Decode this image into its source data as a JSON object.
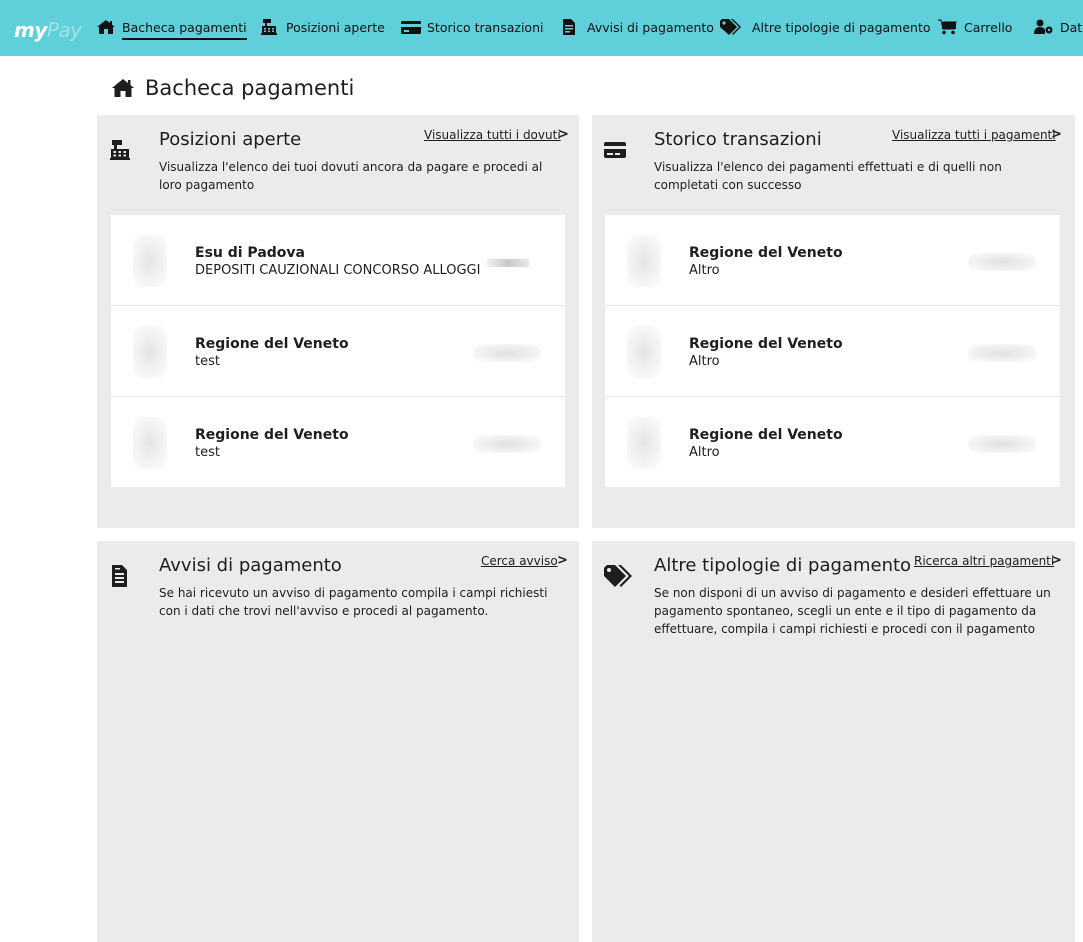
{
  "app": {
    "logo_my": "my",
    "logo_pay": "Pay"
  },
  "nav": {
    "items": [
      {
        "label": "Bacheca pagamenti",
        "icon": "home-icon",
        "active": true
      },
      {
        "label": "Posizioni aperte",
        "icon": "cash-register-icon"
      },
      {
        "label": "Storico transazioni",
        "icon": "credit-card-icon"
      },
      {
        "label": "Avvisi di pagamento",
        "icon": "file-invoice-icon"
      },
      {
        "label": "Altre tipologie di pagamento",
        "icon": "tags-icon"
      },
      {
        "label": "Carrello",
        "icon": "cart-icon"
      },
      {
        "label": "Dat",
        "icon": "user-cog-icon"
      }
    ]
  },
  "page": {
    "title": "Bacheca pagamenti"
  },
  "panels": {
    "posizioni": {
      "title": "Posizioni aperte",
      "description": "Visualizza l'elenco dei tuoi dovuti ancora da pagare e procedi al loro pagamento",
      "link": "Visualizza tutti i dovuti",
      "items": [
        {
          "ente": "Esu di Padova",
          "causale": "DEPOSITI CAUZIONALI CONCORSO ALLOGGI"
        },
        {
          "ente": "Regione del Veneto",
          "causale": "test"
        },
        {
          "ente": "Regione del Veneto",
          "causale": "test"
        }
      ]
    },
    "storico": {
      "title": "Storico transazioni",
      "description": "Visualizza l'elenco dei pagamenti effettuati e di quelli non completati con successo",
      "link": "Visualizza tutti i pagamenti",
      "items": [
        {
          "ente": "Regione del Veneto",
          "causale": "Altro"
        },
        {
          "ente": "Regione del Veneto",
          "causale": "Altro"
        },
        {
          "ente": "Regione del Veneto",
          "causale": "Altro"
        }
      ]
    },
    "avvisi": {
      "title": "Avvisi di pagamento",
      "description": "Se hai ricevuto un avviso di pagamento compila i campi richiesti con i dati che trovi nell'avviso e procedi al pagamento.",
      "link": "Cerca avviso"
    },
    "altre": {
      "title": "Altre tipologie di pagamento",
      "description": "Se non disponi di un avviso di pagamento e desideri effettuare un pagamento spontaneo, scegli un ente e il tipo di pagamento da effettuare, compila i campi richiesti e procedi con il pagamento",
      "link": "Ricerca altri pagamenti"
    }
  },
  "chevron": ">"
}
